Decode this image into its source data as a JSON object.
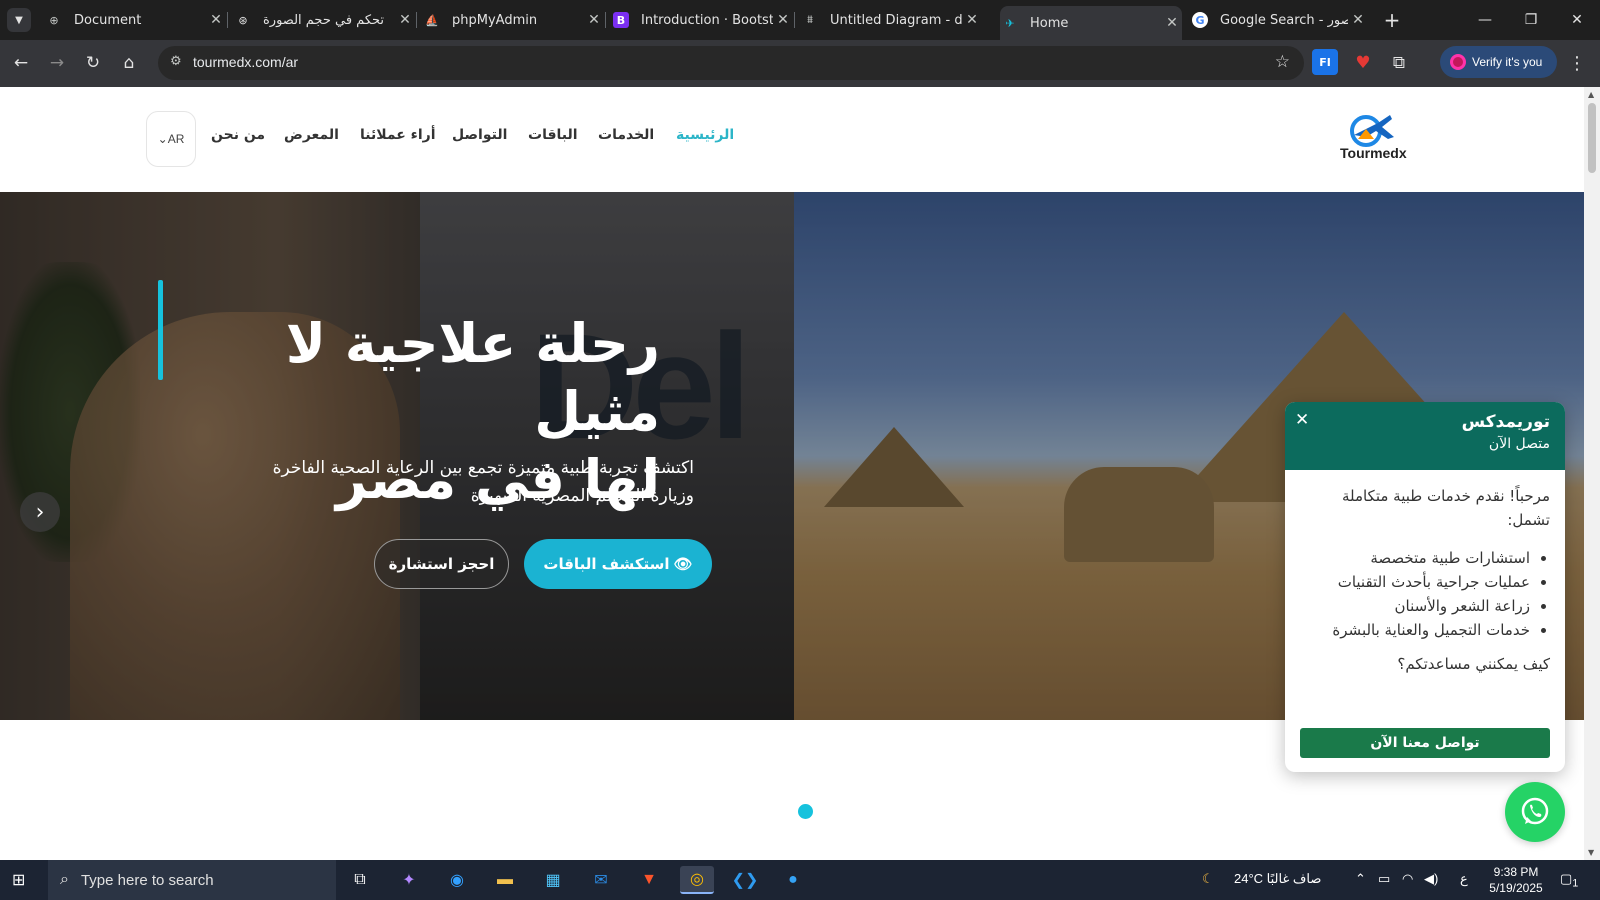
{
  "browser": {
    "tabs": [
      {
        "title": "Document",
        "active": false
      },
      {
        "title": "تحكم في حجم الصورة",
        "active": false
      },
      {
        "title": "phpMyAdmin",
        "active": false
      },
      {
        "title": "Introduction · Bootstra",
        "active": false
      },
      {
        "title": "Untitled Diagram - dra",
        "active": false
      },
      {
        "title": "Home",
        "active": true
      },
      {
        "title": "Google Search - صور",
        "active": false
      }
    ],
    "url": "tourmedx.com/ar",
    "verify_label": "Verify it's you",
    "ext_label": "FI"
  },
  "site": {
    "logo_text": "Tourmedx",
    "nav": [
      {
        "label": "الرئيسية",
        "active": true
      },
      {
        "label": "الخدمات",
        "active": false
      },
      {
        "label": "الباقات",
        "active": false
      },
      {
        "label": "التواصل",
        "active": false
      },
      {
        "label": "أراء عملائنا",
        "active": false
      },
      {
        "label": "المعرض",
        "active": false
      },
      {
        "label": "من نحن",
        "active": false
      }
    ],
    "lang": "AR",
    "hero": {
      "title_line1": "رحلة علاجية لا مثيل",
      "title_line2": "لها في مصر",
      "subtitle_line1": "اكتشف تجربة طبية متميزة تجمع بين الرعاية الصحية الفاخرة",
      "subtitle_line2": "وزيارة المعالم المصرية الشهيرة",
      "primary_cta": "استكشف الباقات",
      "secondary_cta": "احجز استشارة",
      "slide_sign": "Del"
    },
    "chat": {
      "title": "توريمدكس",
      "status": "متصل الآن",
      "greeting": "مرحباً! نقدم خدمات طبية متكاملة تشمل:",
      "items": [
        "استشارات طبية متخصصة",
        "عمليات جراحية بأحدث التقنيات",
        "زراعة الشعر والأسنان",
        "خدمات التجميل والعناية بالبشرة"
      ],
      "question": "كيف يمكنني مساعدتكم؟",
      "cta": "تواصل معنا الآن"
    }
  },
  "taskbar": {
    "search_placeholder": "Type here to search",
    "weather": "24°C  صاف غالبًا",
    "lang_indicator": "ع",
    "time": "9:38 PM",
    "date": "5/19/2025",
    "notif_count": "1"
  },
  "colors": {
    "accent": "#16c2dd",
    "chat_header": "#0c6b5d",
    "whatsapp": "#25d366",
    "cta_green": "#1a7a4a"
  }
}
